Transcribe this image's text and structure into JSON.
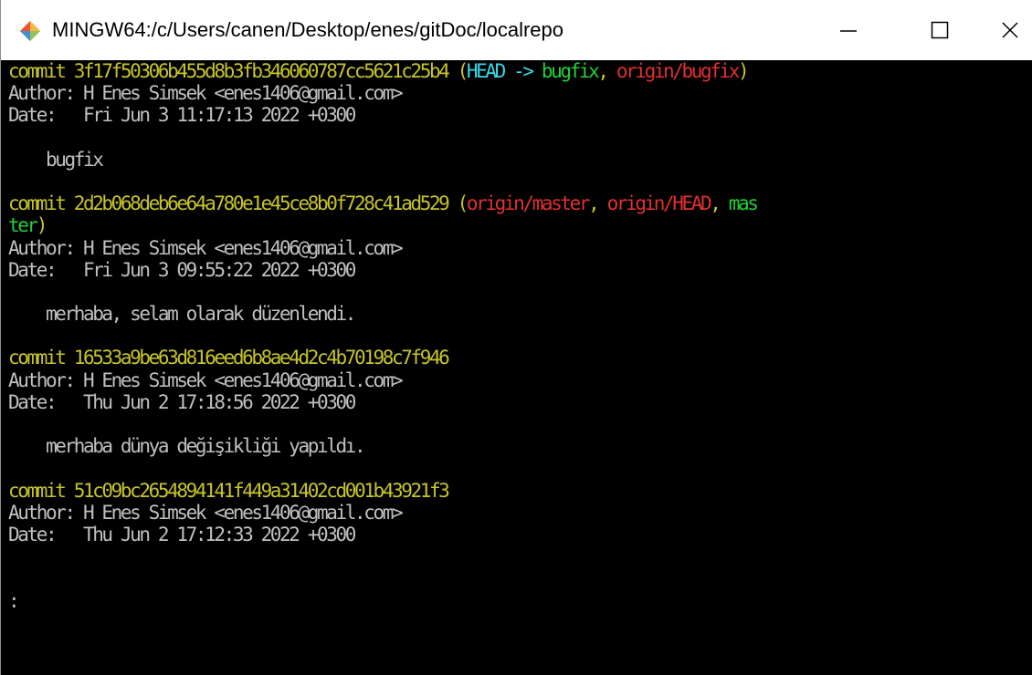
{
  "window": {
    "title": "MINGW64:/c/Users/canen/Desktop/enes/gitDoc/localrepo",
    "icon": "git-bash-icon",
    "controls": [
      "minimize",
      "maximize",
      "close"
    ]
  },
  "colors": {
    "background": "#000000",
    "text": "#c0c0c0",
    "commit": "#c7c42a",
    "head": "#3ad7e6",
    "local_branch": "#21d03a",
    "remote_branch": "#e13030"
  },
  "terminal": {
    "lines": [
      {
        "segments": [
          {
            "text": "commit 3f17f50306b455d8b3fb346060787cc5621c25b4 ",
            "color": "yellow"
          },
          {
            "text": "(",
            "color": "yellow"
          },
          {
            "text": "HEAD -> ",
            "color": "cyan"
          },
          {
            "text": "bugfix",
            "color": "green"
          },
          {
            "text": ", ",
            "color": "yellow"
          },
          {
            "text": "origin/bugfix",
            "color": "red"
          },
          {
            "text": ")",
            "color": "yellow"
          }
        ]
      },
      {
        "segments": [
          {
            "text": "Author: H Enes Simsek <enes1406@gmail.com>",
            "color": "white"
          }
        ]
      },
      {
        "segments": [
          {
            "text": "Date:   Fri Jun 3 11:17:13 2022 +0300",
            "color": "white"
          }
        ]
      },
      {
        "segments": [
          {
            "text": "",
            "color": "white"
          }
        ]
      },
      {
        "segments": [
          {
            "text": "    bugfix",
            "color": "white"
          }
        ]
      },
      {
        "segments": [
          {
            "text": "",
            "color": "white"
          }
        ]
      },
      {
        "segments": [
          {
            "text": "commit 2d2b068deb6e64a780e1e45ce8b0f728c41ad529 ",
            "color": "yellow"
          },
          {
            "text": "(",
            "color": "yellow"
          },
          {
            "text": "origin/master",
            "color": "red"
          },
          {
            "text": ", ",
            "color": "yellow"
          },
          {
            "text": "origin/HEAD",
            "color": "red"
          },
          {
            "text": ", ",
            "color": "yellow"
          },
          {
            "text": "mas",
            "color": "green"
          }
        ]
      },
      {
        "segments": [
          {
            "text": "ter",
            "color": "green"
          },
          {
            "text": ")",
            "color": "yellow"
          }
        ]
      },
      {
        "segments": [
          {
            "text": "Author: H Enes Simsek <enes1406@gmail.com>",
            "color": "white"
          }
        ]
      },
      {
        "segments": [
          {
            "text": "Date:   Fri Jun 3 09:55:22 2022 +0300",
            "color": "white"
          }
        ]
      },
      {
        "segments": [
          {
            "text": "",
            "color": "white"
          }
        ]
      },
      {
        "segments": [
          {
            "text": "    merhaba, selam olarak düzenlendi.",
            "color": "white"
          }
        ]
      },
      {
        "segments": [
          {
            "text": "",
            "color": "white"
          }
        ]
      },
      {
        "segments": [
          {
            "text": "commit 16533a9be63d816eed6b8ae4d2c4b70198c7f946",
            "color": "yellow"
          }
        ]
      },
      {
        "segments": [
          {
            "text": "Author: H Enes Simsek <enes1406@gmail.com>",
            "color": "white"
          }
        ]
      },
      {
        "segments": [
          {
            "text": "Date:   Thu Jun 2 17:18:56 2022 +0300",
            "color": "white"
          }
        ]
      },
      {
        "segments": [
          {
            "text": "",
            "color": "white"
          }
        ]
      },
      {
        "segments": [
          {
            "text": "    merhaba dünya değişikliği yapıldı.",
            "color": "white"
          }
        ]
      },
      {
        "segments": [
          {
            "text": "",
            "color": "white"
          }
        ]
      },
      {
        "segments": [
          {
            "text": "commit 51c09bc2654894141f449a31402cd001b43921f3",
            "color": "yellow"
          }
        ]
      },
      {
        "segments": [
          {
            "text": "Author: H Enes Simsek <enes1406@gmail.com>",
            "color": "white"
          }
        ]
      },
      {
        "segments": [
          {
            "text": "Date:   Thu Jun 2 17:12:33 2022 +0300",
            "color": "white"
          }
        ]
      },
      {
        "segments": [
          {
            "text": "",
            "color": "white"
          }
        ]
      },
      {
        "segments": [
          {
            "text": "",
            "color": "white"
          }
        ]
      },
      {
        "segments": [
          {
            "text": ":",
            "color": "white"
          }
        ]
      }
    ]
  }
}
